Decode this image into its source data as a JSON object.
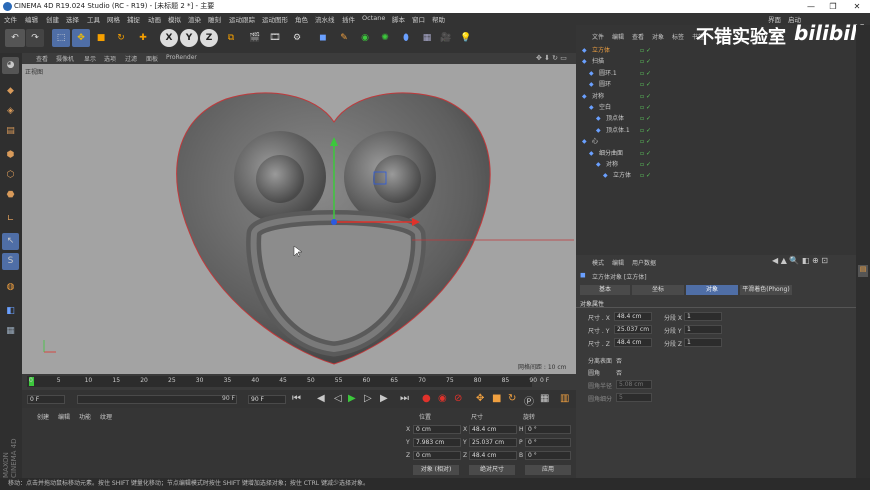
{
  "titlebar": {
    "title": "CINEMA 4D R19.024 Studio (RC - R19) - [未标题 2 *] - 主要",
    "minimize": "—",
    "maximize": "❐",
    "close": "✕"
  },
  "menu": [
    "文件",
    "编辑",
    "创建",
    "选择",
    "工具",
    "网格",
    "捕捉",
    "动画",
    "模拟",
    "渲染",
    "雕刻",
    "运动跟踪",
    "运动图形",
    "角色",
    "流水线",
    "插件",
    "Octane",
    "脚本",
    "窗口",
    "帮助"
  ],
  "layout": {
    "label": "界面",
    "value": "启动"
  },
  "viewport": {
    "menu": [
      "查看",
      "摄像机",
      "显示",
      "选项",
      "过滤",
      "面板",
      "ProRender"
    ],
    "camera_label": "正视图",
    "grid_label": "网格间距 : 10 cm"
  },
  "timeline": {
    "ticks": [
      "0",
      "5",
      "10",
      "15",
      "20",
      "25",
      "30",
      "35",
      "40",
      "45",
      "50",
      "55",
      "60",
      "65",
      "70",
      "75",
      "80",
      "85",
      "90"
    ],
    "end": "0 F",
    "start_field": "0 F",
    "current_field": "0 F",
    "max_field": "90 F",
    "max2_field": "90 F"
  },
  "material_manager": {
    "menu": [
      "创建",
      "编辑",
      "功能",
      "纹理"
    ]
  },
  "coords": {
    "headers": [
      "位置",
      "尺寸",
      "旋转"
    ],
    "rows": [
      {
        "axis": "X",
        "pos": "0 cm",
        "size": "48.4 cm",
        "rlabel": "H",
        "rot": "0 °"
      },
      {
        "axis": "Y",
        "pos": "7.983 cm",
        "size": "25.037 cm",
        "rlabel": "P",
        "rot": "0 °"
      },
      {
        "axis": "Z",
        "pos": "0 cm",
        "size": "48.4 cm",
        "rlabel": "B",
        "rot": "0 °"
      }
    ],
    "mode1": "对象 (相对)",
    "mode2": "绝对尺寸",
    "apply": "应用"
  },
  "status": "移动：点击并拖动鼠标移动元素。按住 SHIFT 键量化移动；节点编辑模式时按住 SHIFT 键增加选择对象；按住 CTRL 键减少选择对象。",
  "object_manager": {
    "menu": [
      "文件",
      "编辑",
      "查看",
      "对象",
      "标签",
      "书签"
    ],
    "items": [
      {
        "name": "立方体",
        "indent": 0
      },
      {
        "name": "扫描",
        "indent": 0
      },
      {
        "name": "圆环.1",
        "indent": 1
      },
      {
        "name": "圆环",
        "indent": 1
      },
      {
        "name": "对称",
        "indent": 0
      },
      {
        "name": "空白",
        "indent": 1
      },
      {
        "name": "顶点体",
        "indent": 2
      },
      {
        "name": "顶点体.1",
        "indent": 2
      },
      {
        "name": "心",
        "indent": 0
      },
      {
        "name": "细分曲面",
        "indent": 1
      },
      {
        "name": "对称",
        "indent": 2
      },
      {
        "name": "立方体",
        "indent": 3
      }
    ]
  },
  "attributes": {
    "menu": [
      "模式",
      "编辑",
      "用户数据"
    ],
    "title": "立方体对象 [立方体]",
    "tabs": [
      "基本",
      "坐标",
      "对象",
      "平滑着色(Phong)"
    ],
    "active_tab": "对象",
    "section": "对象属性",
    "fields": [
      {
        "label": "尺寸 . X",
        "value": "48.4 cm",
        "seg_label": "分段 X",
        "seg": "1"
      },
      {
        "label": "尺寸 . Y",
        "value": "25.037 cm",
        "seg_label": "分段 Y",
        "seg": "1"
      },
      {
        "label": "尺寸 . Z",
        "value": "48.4 cm",
        "seg_label": "分段 Z",
        "seg": "1"
      }
    ],
    "sep_label": "分离表面",
    "sep_val": "否",
    "fillet_label": "圆角",
    "fillet_val": "否",
    "fr_label": "圆角半径",
    "fr_val": "5.08 cm",
    "fs_label": "圆角细分",
    "fs_val": "5"
  },
  "watermark": {
    "text": "不错实验室",
    "brand": "bilibili"
  },
  "colors": {
    "accent": "#4f6ea6",
    "axis_x": "#e0322b",
    "axis_y": "#3cc83c",
    "axis_z": "#2b5ae0"
  }
}
